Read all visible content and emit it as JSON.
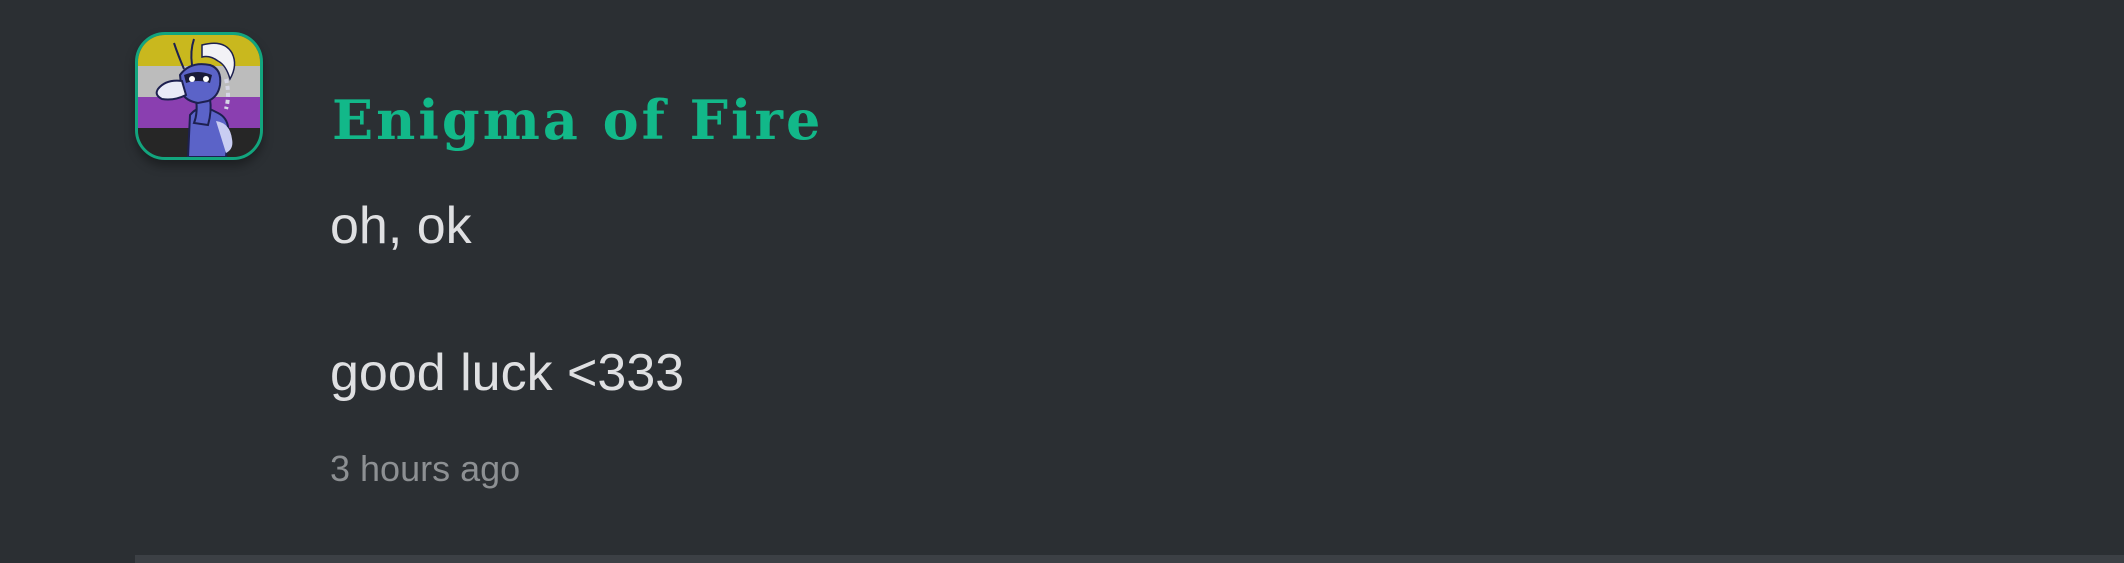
{
  "comment": {
    "author": "Enigma of Fire",
    "lines": [
      "oh, ok",
      "good luck <333"
    ],
    "time": "3 hours ago",
    "avatar_icon": "dragon-avatar-nonbinary-flag",
    "avatar_border_color": "#12a57e",
    "author_color": "#12b889"
  }
}
